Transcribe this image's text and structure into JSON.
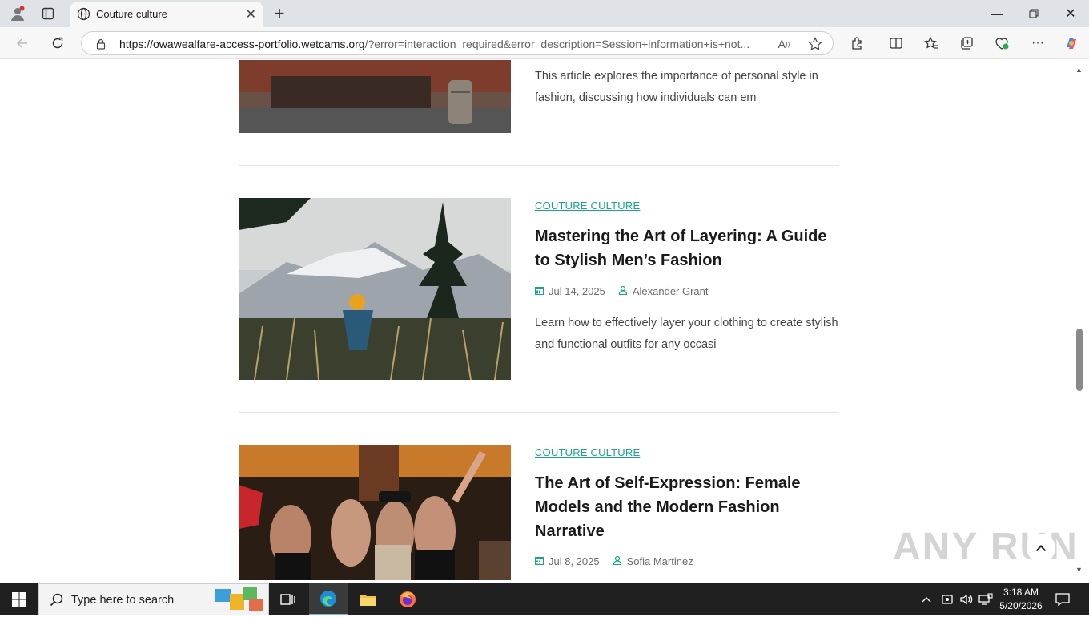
{
  "browser": {
    "tab_title": "Couture culture",
    "url_host": "https://owawealfare-access-portfolio.wetcams.org",
    "url_rest": "/?error=interaction_required&error_description=Session+information+is+not..."
  },
  "articles": [
    {
      "excerpt": "This article explores the importance of personal style in fashion, discussing how individuals can em"
    },
    {
      "category": "COUTURE CULTURE",
      "title": "Mastering the Art of Layering: A Guide to Stylish Men’s Fashion",
      "date": "Jul 14, 2025",
      "author": "Alexander Grant",
      "excerpt": "Learn how to effectively layer your clothing to create stylish and functional outfits for any occasi"
    },
    {
      "category": "COUTURE CULTURE",
      "title": "The Art of Self-Expression: Female Models and the Modern Fashion Narrative",
      "date": "Jul 8, 2025",
      "author": "Sofia Martinez"
    }
  ],
  "watermark": "ANY RUN",
  "taskbar": {
    "search_placeholder": "Type here to search",
    "time": "3:18 AM",
    "date": "5/20/2026"
  },
  "colors": {
    "accent": "#1aa58b",
    "taskbar": "#202020"
  }
}
